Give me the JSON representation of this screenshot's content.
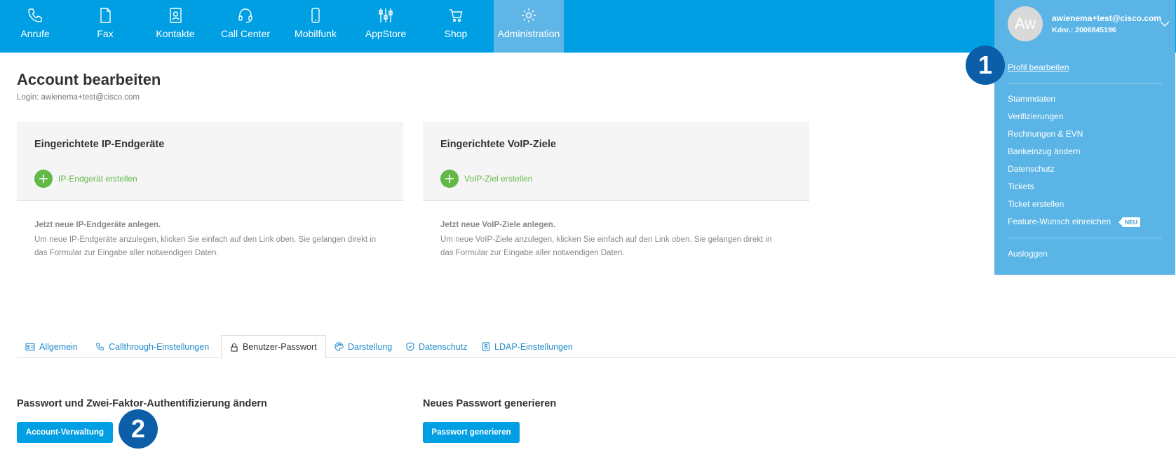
{
  "nav": {
    "items": [
      {
        "label": "Anrufe",
        "icon": "phone-icon"
      },
      {
        "label": "Fax",
        "icon": "document-icon"
      },
      {
        "label": "Kontakte",
        "icon": "contact-card-icon"
      },
      {
        "label": "Call Center",
        "icon": "headset-icon"
      },
      {
        "label": "Mobilfunk",
        "icon": "mobile-phone-icon"
      },
      {
        "label": "AppStore",
        "icon": "sliders-icon"
      },
      {
        "label": "Shop",
        "icon": "shopping-cart-icon"
      },
      {
        "label": "Administration",
        "icon": "gear-icon"
      }
    ],
    "active": "Administration",
    "color": "#009fe3",
    "active_color": "#5fb6e6"
  },
  "user": {
    "avatar_initials": "Aw",
    "email": "awienema+test@cisco.com",
    "kdnr": "Kdnr.: 2006845196",
    "menu": {
      "profile": "Profil bearbeiten",
      "links": [
        "Stammdaten",
        "Verifizierungen",
        "Rechnungen & EVN",
        "Bankeinzug ändern",
        "Datenschutz",
        "Tickets",
        "Ticket erstellen",
        "Feature-Wunsch einreichen"
      ],
      "new_badge": "NEU",
      "logout": "Ausloggen"
    }
  },
  "markers": {
    "one": "1",
    "two": "2"
  },
  "page": {
    "title": "Account bearbeiten",
    "login": "Login: awienema+test@cisco.com"
  },
  "cards": {
    "ip": {
      "title": "Eingerichtete IP-Endgeräte",
      "add_label": "IP-Endgerät erstellen",
      "hint_title": "Jetzt neue IP-Endgeräte anlegen.",
      "hint_text": "Um neue IP-Endgeräte anzulegen, klicken Sie einfach auf den Link oben. Sie gelangen direkt in das Formular zur Eingabe aller notwendigen Daten."
    },
    "voip": {
      "title": "Eingerichtete VoIP-Ziele",
      "add_label": "VoIP-Ziel erstellen",
      "hint_title": "Jetzt neue VoIP-Ziele anlegen.",
      "hint_text": "Um neue VoIP-Ziele anzulegen, klicken Sie einfach auf den Link oben. Sie gelangen direkt in das Formular zur Eingabe aller notwendigen Daten."
    }
  },
  "tabs": {
    "items": [
      "Allgemein",
      "Callthrough-Einstellungen",
      "Benutzer-Passwort",
      "Darstellung",
      "Datenschutz",
      "LDAP-Einstellungen"
    ],
    "active": "Benutzer-Passwort"
  },
  "sections": {
    "password": {
      "title": "Passwort und Zwei-Faktor-Authentifizierung ändern",
      "button": "Account-Verwaltung"
    },
    "generate": {
      "title": "Neues Passwort generieren",
      "button": "Passwort generieren"
    }
  }
}
